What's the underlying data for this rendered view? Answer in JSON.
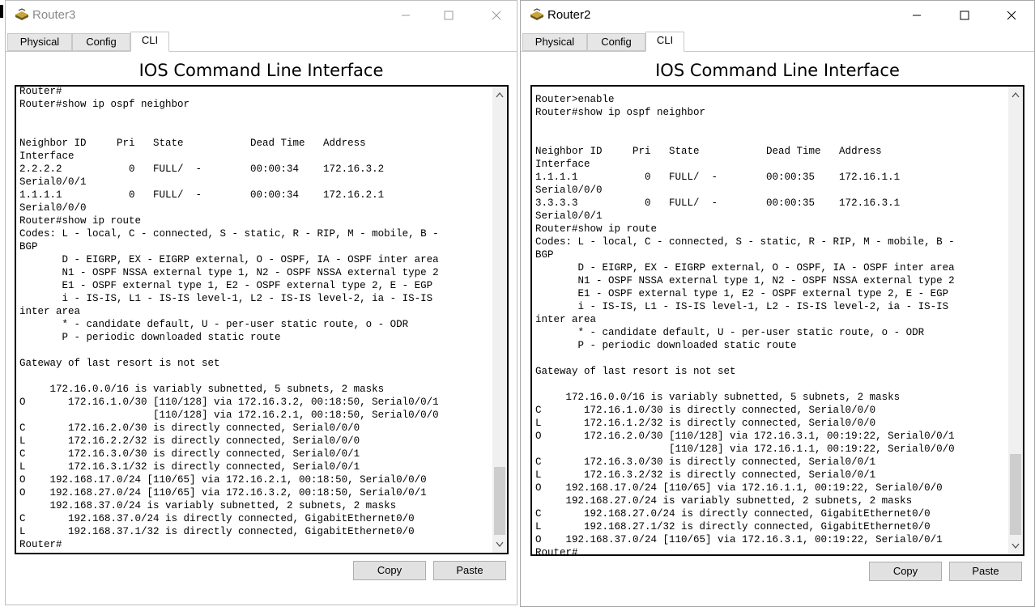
{
  "left_window": {
    "title": "Router3",
    "tabs": [
      "Physical",
      "Config",
      "CLI"
    ],
    "active_tab": "CLI",
    "heading": "IOS Command Line Interface",
    "cli_lines": [
      "Router#",
      "Router#show ip ospf neighbor",
      "",
      "",
      "Neighbor ID     Pri   State           Dead Time   Address",
      "Interface",
      "2.2.2.2           0   FULL/  -        00:00:34    172.16.3.2",
      "Serial0/0/1",
      "1.1.1.1           0   FULL/  -        00:00:34    172.16.2.1",
      "Serial0/0/0",
      "Router#show ip route",
      "Codes: L - local, C - connected, S - static, R - RIP, M - mobile, B -",
      "BGP",
      "       D - EIGRP, EX - EIGRP external, O - OSPF, IA - OSPF inter area",
      "       N1 - OSPF NSSA external type 1, N2 - OSPF NSSA external type 2",
      "       E1 - OSPF external type 1, E2 - OSPF external type 2, E - EGP",
      "       i - IS-IS, L1 - IS-IS level-1, L2 - IS-IS level-2, ia - IS-IS",
      "inter area",
      "       * - candidate default, U - per-user static route, o - ODR",
      "       P - periodic downloaded static route",
      "",
      "Gateway of last resort is not set",
      "",
      "     172.16.0.0/16 is variably subnetted, 5 subnets, 2 masks",
      "O       172.16.1.0/30 [110/128] via 172.16.3.2, 00:18:50, Serial0/0/1",
      "                      [110/128] via 172.16.2.1, 00:18:50, Serial0/0/0",
      "C       172.16.2.0/30 is directly connected, Serial0/0/0",
      "L       172.16.2.2/32 is directly connected, Serial0/0/0",
      "C       172.16.3.0/30 is directly connected, Serial0/0/1",
      "L       172.16.3.1/32 is directly connected, Serial0/0/1",
      "O    192.168.17.0/24 [110/65] via 172.16.2.1, 00:18:50, Serial0/0/0",
      "O    192.168.27.0/24 [110/65] via 172.16.3.2, 00:18:50, Serial0/0/1",
      "     192.168.37.0/24 is variably subnetted, 2 subnets, 2 masks",
      "C       192.168.37.0/24 is directly connected, GigabitEthernet0/0",
      "L       192.168.37.1/32 is directly connected, GigabitEthernet0/0",
      "Router#"
    ],
    "copy_label": "Copy",
    "paste_label": "Paste"
  },
  "right_window": {
    "title": "Router2",
    "tabs": [
      "Physical",
      "Config",
      "CLI"
    ],
    "active_tab": "CLI",
    "heading": "IOS Command Line Interface",
    "cli_lines": [
      "Router>enable",
      "Router#show ip ospf neighbor",
      "",
      "",
      "Neighbor ID     Pri   State           Dead Time   Address",
      "Interface",
      "1.1.1.1           0   FULL/  -        00:00:35    172.16.1.1",
      "Serial0/0/0",
      "3.3.3.3           0   FULL/  -        00:00:35    172.16.3.1",
      "Serial0/0/1",
      "Router#show ip route",
      "Codes: L - local, C - connected, S - static, R - RIP, M - mobile, B -",
      "BGP",
      "       D - EIGRP, EX - EIGRP external, O - OSPF, IA - OSPF inter area",
      "       N1 - OSPF NSSA external type 1, N2 - OSPF NSSA external type 2",
      "       E1 - OSPF external type 1, E2 - OSPF external type 2, E - EGP",
      "       i - IS-IS, L1 - IS-IS level-1, L2 - IS-IS level-2, ia - IS-IS",
      "inter area",
      "       * - candidate default, U - per-user static route, o - ODR",
      "       P - periodic downloaded static route",
      "",
      "Gateway of last resort is not set",
      "",
      "     172.16.0.0/16 is variably subnetted, 5 subnets, 2 masks",
      "C       172.16.1.0/30 is directly connected, Serial0/0/0",
      "L       172.16.1.2/32 is directly connected, Serial0/0/0",
      "O       172.16.2.0/30 [110/128] via 172.16.3.1, 00:19:22, Serial0/0/1",
      "                      [110/128] via 172.16.1.1, 00:19:22, Serial0/0/0",
      "C       172.16.3.0/30 is directly connected, Serial0/0/1",
      "L       172.16.3.2/32 is directly connected, Serial0/0/1",
      "O    192.168.17.0/24 [110/65] via 172.16.1.1, 00:19:22, Serial0/0/0",
      "     192.168.27.0/24 is variably subnetted, 2 subnets, 2 masks",
      "C       192.168.27.0/24 is directly connected, GigabitEthernet0/0",
      "L       192.168.27.1/32 is directly connected, GigabitEthernet0/0",
      "O    192.168.37.0/24 [110/65] via 172.16.3.1, 00:19:22, Serial0/0/1",
      "Router#"
    ],
    "copy_label": "Copy",
    "paste_label": "Paste"
  },
  "icons": [
    "router-icon",
    "minimize-icon",
    "maximize-icon",
    "close-icon",
    "scroll-up-icon",
    "scroll-down-icon"
  ]
}
